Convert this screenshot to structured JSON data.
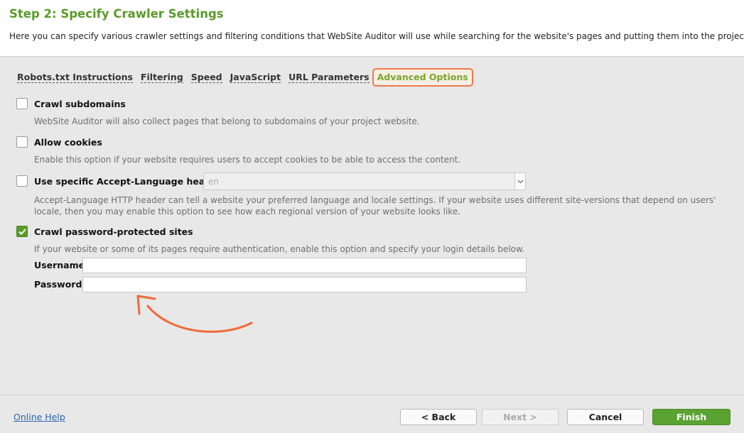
{
  "header": {
    "title": "Step 2: Specify Crawler Settings",
    "description": "Here you can specify various crawler settings and filtering conditions that WebSite Auditor will use while searching for the website's pages and putting them into the project."
  },
  "tabs": [
    {
      "label": "Robots.txt Instructions"
    },
    {
      "label": "Filtering"
    },
    {
      "label": "Speed"
    },
    {
      "label": "JavaScript"
    },
    {
      "label": "URL Parameters"
    },
    {
      "label": "Advanced Options"
    }
  ],
  "options": {
    "crawl_subdomains": {
      "label": "Crawl subdomains",
      "hint": "WebSite Auditor will also collect pages that belong to subdomains of your project website.",
      "checked": false
    },
    "allow_cookies": {
      "label": "Allow cookies",
      "hint": "Enable this option if your website requires users to accept cookies to be able to access the content.",
      "checked": false
    },
    "accept_language": {
      "label": "Use specific Accept-Language header",
      "value": "en",
      "hint": "Accept-Language HTTP header can tell a website your preferred language and locale settings. If your website uses different site-versions that depend on users' locale, then you may enable this option to see how each regional version of your website looks like.",
      "checked": false
    },
    "password_protected": {
      "label": "Crawl password-protected sites",
      "hint": "If your website or some of its pages require authentication, enable this option and specify your login details below.",
      "checked": true,
      "username_label": "Username",
      "password_label": "Password",
      "username_value": "",
      "password_value": ""
    }
  },
  "footer": {
    "help_link": "Online Help",
    "back": "< Back",
    "next": "Next >",
    "cancel": "Cancel",
    "finish": "Finish"
  },
  "colors": {
    "accent_green": "#5a9a2a",
    "annotation_orange": "#f26a36"
  }
}
